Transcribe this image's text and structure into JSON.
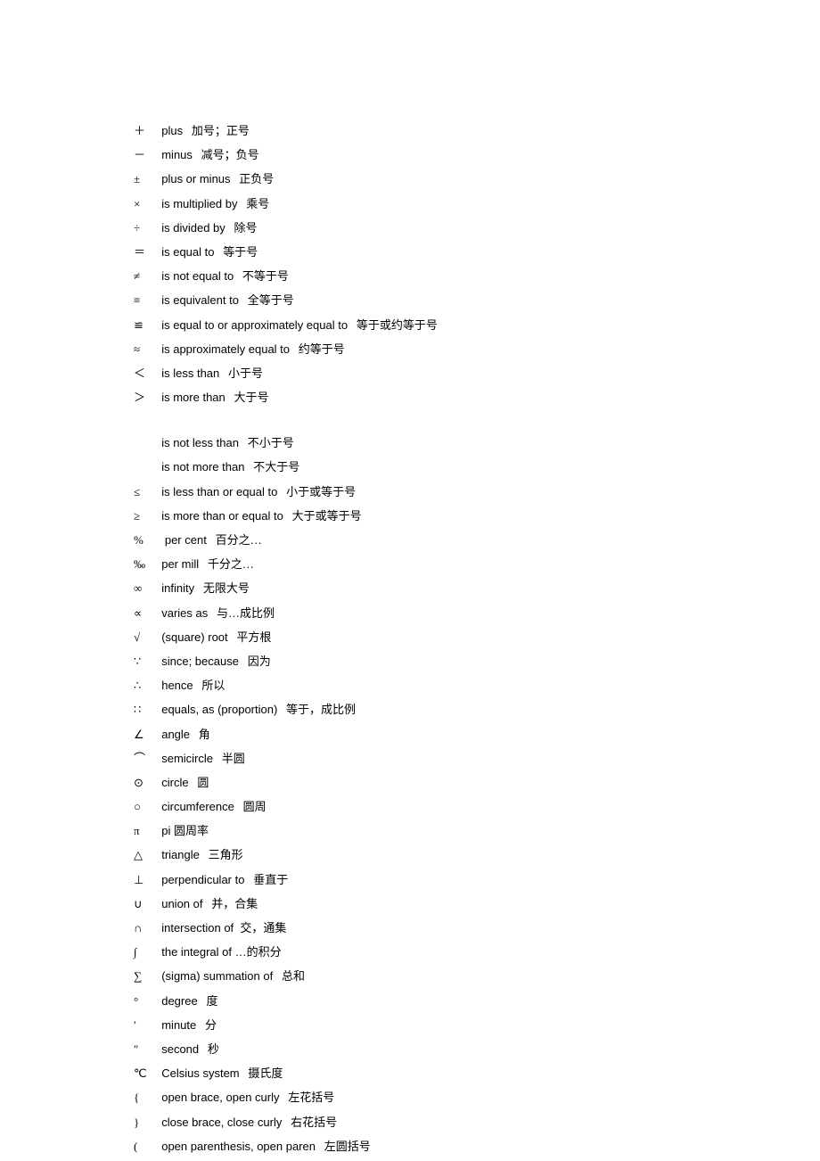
{
  "entries": [
    {
      "symbol": "＋",
      "english": "plus",
      "chinese": "加号；正号"
    },
    {
      "symbol": "－",
      "english": "minus",
      "chinese": "减号；负号"
    },
    {
      "symbol": "±",
      "english": "plus or minus",
      "chinese": "正负号"
    },
    {
      "symbol": "×",
      "english": "is multiplied by",
      "chinese": "乘号"
    },
    {
      "symbol": "÷",
      "english": "is divided by",
      "chinese": "除号"
    },
    {
      "symbol": "＝",
      "english": "is equal to",
      "chinese": "等于号"
    },
    {
      "symbol": "≠",
      "english": "is not equal to",
      "chinese": "不等于号"
    },
    {
      "symbol": "≡",
      "english": "is equivalent to",
      "chinese": "全等于号"
    },
    {
      "symbol": "≌",
      "english": "is equal to or approximately equal to",
      "chinese": "等于或约等于号"
    },
    {
      "symbol": "≈",
      "english": "is approximately equal to",
      "chinese": "约等于号"
    },
    {
      "symbol": "＜",
      "english": "is less than",
      "chinese": "小于号"
    },
    {
      "symbol": "＞",
      "english": "is more than",
      "chinese": "大于号"
    }
  ],
  "entries2": [
    {
      "symbol": " ",
      "english": "is not less than",
      "chinese": "不小于号"
    },
    {
      "symbol": " ",
      "english": "is not more than",
      "chinese": "不大于号"
    },
    {
      "symbol": "≤",
      "english": "is less than or equal to",
      "chinese": "小于或等于号"
    },
    {
      "symbol": "≥",
      "english": "is more than or equal to",
      "chinese": "大于或等于号"
    },
    {
      "symbol": "%",
      "english": " per cent",
      "chinese": "百分之…"
    },
    {
      "symbol": "‰",
      "english": "per mill",
      "chinese": "千分之…"
    },
    {
      "symbol": "∞",
      "english": "infinity",
      "chinese": "无限大号"
    },
    {
      "symbol": "∝",
      "english": "varies as",
      "chinese": "与…成比例"
    },
    {
      "symbol": "√",
      "english": "(square) root",
      "chinese": "平方根"
    },
    {
      "symbol": "∵",
      "english": "since; because",
      "chinese": "因为"
    },
    {
      "symbol": "∴",
      "english": "hence",
      "chinese": "所以"
    },
    {
      "symbol": "∷",
      "english": "equals, as (proportion)",
      "chinese": "等于，成比例"
    },
    {
      "symbol": "∠",
      "english": "angle",
      "chinese": "角"
    },
    {
      "symbol": "⌒",
      "english": "semicircle",
      "chinese": "半圆"
    },
    {
      "symbol": "⊙",
      "english": "circle",
      "chinese": "圆"
    },
    {
      "symbol": "○",
      "english": "circumference",
      "chinese": "圆周"
    },
    {
      "symbol": "π",
      "english": "pi 圆周率",
      "chinese": ""
    },
    {
      "symbol": "△",
      "english": "triangle",
      "chinese": "三角形"
    },
    {
      "symbol": "⊥",
      "english": "perpendicular to",
      "chinese": "垂直于"
    },
    {
      "symbol": "∪",
      "english": "union of",
      "chinese": "并，合集"
    },
    {
      "symbol": "∩",
      "english": "intersection of  交，通集",
      "chinese": ""
    },
    {
      "symbol": "∫",
      "english": "the integral of …的积分",
      "chinese": ""
    },
    {
      "symbol": "∑",
      "english": "(sigma) summation of",
      "chinese": "总和"
    },
    {
      "symbol": "°",
      "english": "degree",
      "chinese": "度"
    },
    {
      "symbol": "′",
      "english": "minute",
      "chinese": "分"
    },
    {
      "symbol": "″",
      "english": "second",
      "chinese": "秒"
    },
    {
      "symbol": "℃",
      "english": "Celsius system",
      "chinese": "摄氏度"
    },
    {
      "symbol": "{",
      "english": "open brace, open curly",
      "chinese": "左花括号"
    },
    {
      "symbol": "}",
      "english": "close brace, close curly",
      "chinese": "右花括号"
    },
    {
      "symbol": "(",
      "english": "open parenthesis, open paren",
      "chinese": "左圆括号"
    }
  ]
}
